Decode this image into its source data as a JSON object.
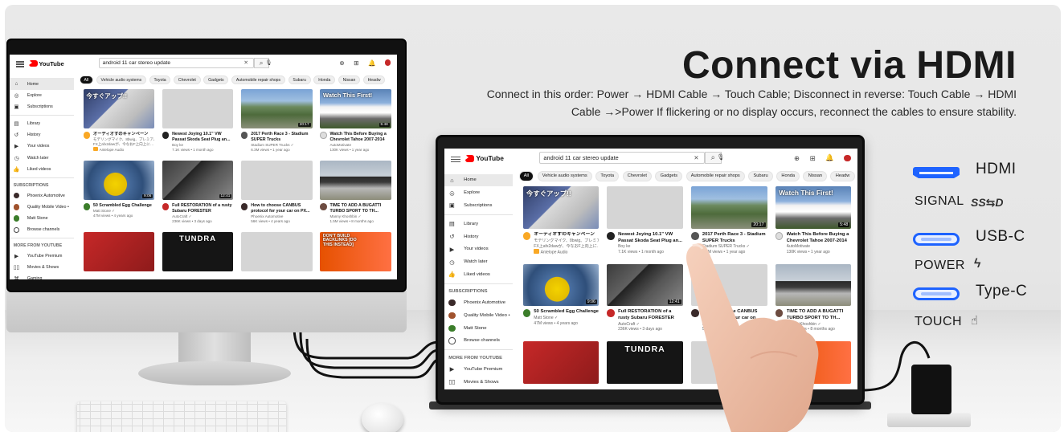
{
  "headline": "Connect via HDMI",
  "subline": "Connect in this order: Power → HDMI Cable → Touch Cable; Disconnect in reverse: Touch Cable → HDMI Cable →>Power If flickering or no display occurs, reconnect the cables to ensure stability.",
  "legend": {
    "hdmi": "HDMI",
    "signal": "SIGNAL",
    "signal_icon": "SS⇆D",
    "usbc": "USB-C",
    "power": "POWER",
    "power_icon": "ϟ",
    "typec": "Type-C",
    "touch": "TOUCH",
    "touch_icon": "☝"
  },
  "youtube": {
    "logo": "YouTube",
    "search_query": "android 11 car stereo update",
    "search_clear": "✕",
    "search_icon": "⌕",
    "mic_icon": "🎙",
    "sidebar": [
      {
        "icon": "⌂",
        "label": "Home"
      },
      {
        "icon": "◎",
        "label": "Explore"
      },
      {
        "icon": "▣",
        "label": "Subscriptions"
      }
    ],
    "sidebar2": [
      {
        "icon": "▤",
        "label": "Library"
      },
      {
        "icon": "↺",
        "label": "History"
      },
      {
        "icon": "▶",
        "label": "Your videos"
      },
      {
        "icon": "◷",
        "label": "Watch later"
      },
      {
        "icon": "👍",
        "label": "Liked videos"
      }
    ],
    "subscriptions_heading": "SUBSCRIPTIONS",
    "subscriptions": [
      {
        "label": "Phoenix Automotive",
        "color": "#3a2a2a"
      },
      {
        "label": "Quality Mobile Video •",
        "color": "#a0522d"
      },
      {
        "label": "Matt Stone",
        "color": "#3b7d2a"
      },
      {
        "label": "Browse channels",
        "color": "#ffffff"
      }
    ],
    "more_heading": "MORE FROM YOUTUBE",
    "more": [
      {
        "icon": "▶",
        "label": "YouTube Premium"
      },
      {
        "icon": "▯▯",
        "label": "Movies & Shows"
      },
      {
        "icon": "⌘",
        "label": "Gaming"
      }
    ],
    "chips": [
      "All",
      "Vehicle audio systems",
      "Toyota",
      "Chevrolet",
      "Gadgets",
      "Automobile repair shops",
      "Subaru",
      "Honda",
      "Nissan",
      "Headw"
    ],
    "videos": [
      {
        "thumb": "th-jp",
        "overlay": "今すぐアップ!!",
        "duration": "",
        "title": "オーディオすのキャンペーン",
        "channel": "モデリングマイク、8bwig、プレミアム",
        "views": "FX上afx2dawが、今なおF上向上に…",
        "tag": "Antelope Audio",
        "avatar": "#f9a825"
      },
      {
        "thumb": "th-blank",
        "overlay": "",
        "duration": "",
        "title": "Newest Joying 10.1\" VW Passat Skoda Seat Plug an...",
        "channel": "Boy ke",
        "views": "7.1K views • 1 month ago",
        "tag": "",
        "avatar": "#222222"
      },
      {
        "thumb": "th-race",
        "overlay": "",
        "duration": "20:17",
        "title": "2017 Perth Race 3 - Stadium SUPER Trucks",
        "channel": "Stadium SUPER Trucks ✓",
        "views": "6.3M views • 1 year ago",
        "tag": "",
        "avatar": "#555555"
      },
      {
        "thumb": "th-car",
        "overlay": "Watch This First!",
        "duration": "5:48",
        "title": "Watch This Before Buying a Chevrolet Tahoe 2007-2014",
        "channel": "AutoMotivate",
        "views": "130K views • 1 year ago",
        "tag": "",
        "avatar": "#dddddd"
      },
      {
        "thumb": "th-egg",
        "overlay": "",
        "duration": "9:06",
        "title": "50 Scrambled Egg Challenge",
        "channel": "Matt Stone ✓",
        "views": "47M views • 4 years ago",
        "tag": "",
        "avatar": "#3b7d2a"
      },
      {
        "thumb": "th-rust",
        "overlay": "",
        "duration": "12:41",
        "title": "Full RESTORATION of a rusty Subaru FORESTER",
        "channel": "AutoCraft ✓",
        "views": "236K views • 3 days ago",
        "tag": "",
        "avatar": "#c62828"
      },
      {
        "thumb": "th-blank",
        "overlay": "",
        "duration": "",
        "title": "How to choose CANBUS protocol for your car on PX...",
        "channel": "Phoenix Automotive",
        "views": "56K views • 4 years ago",
        "tag": "",
        "avatar": "#3a2a2a"
      },
      {
        "thumb": "th-bug",
        "overlay": "",
        "duration": "",
        "title": "TIME TO ADD A BUGATTI TURBO SPORT TO TH...",
        "channel": "Manny Khoshbin ✓",
        "views": "1.5M views • 8 months ago",
        "tag": "",
        "avatar": "#6d4c41"
      },
      {
        "thumb": "th-red",
        "overlay": "",
        "duration": "",
        "title": "",
        "channel": "",
        "views": "",
        "tag": "",
        "avatar": ""
      },
      {
        "thumb": "th-toyota",
        "overlay": "TUNDRA",
        "duration": "",
        "title": "",
        "channel": "",
        "views": "",
        "tag": "",
        "avatar": ""
      },
      {
        "thumb": "th-blank",
        "overlay": "",
        "duration": "",
        "title": "",
        "channel": "",
        "views": "",
        "tag": "",
        "avatar": ""
      },
      {
        "thumb": "th-build",
        "overlay": "DON'T BUILD BACKLINKS [DO THIS INSTEAD]",
        "duration": "",
        "title": "",
        "channel": "",
        "views": "",
        "tag": "",
        "avatar": ""
      }
    ]
  }
}
